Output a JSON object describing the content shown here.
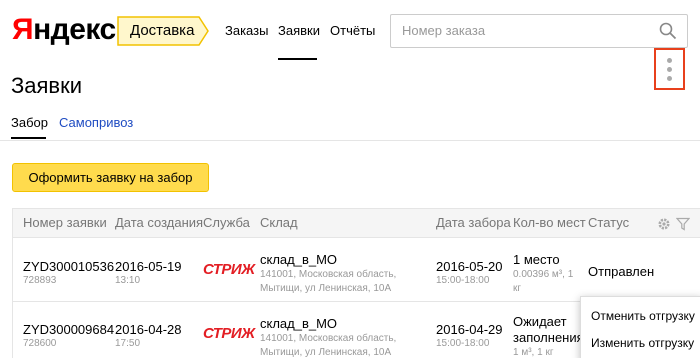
{
  "header": {
    "logo_first": "Я",
    "logo_rest": "ндекс",
    "service": "Доставка",
    "nav": [
      "Заказы",
      "Заявки",
      "Отчёты"
    ],
    "search_placeholder": "Номер заказа"
  },
  "page": {
    "title": "Заявки",
    "tabs": [
      "Забор",
      "Самопривоз"
    ],
    "order_button": "Оформить заявку на забор"
  },
  "table": {
    "headers": [
      "Номер заявки",
      "Дата создания",
      "Служба",
      "Склад",
      "Дата забора",
      "Кол-во мест",
      "Статус"
    ],
    "rows": [
      {
        "number": "ZYD300010536",
        "number_sub": "728893",
        "created": "2016-05-19",
        "created_time": "13:10",
        "carrier": "СТРИЖ",
        "warehouse": "склад_в_МО",
        "address1": "141001, Московская область,",
        "address2": "Мытищи, ул Ленинская, 10А",
        "pickup_date": "2016-05-20",
        "pickup_time": "15:00-18:00",
        "places": "1 место",
        "places_sub1": "0.00396 м³, 1",
        "places_sub2": "кг",
        "status": "Отправлен"
      },
      {
        "number": "ZYD300009684",
        "number_sub": "728600",
        "created": "2016-04-28",
        "created_time": "17:50",
        "carrier": "СТРИЖ",
        "warehouse": "склад_в_МО",
        "address1": "141001, Московская область,",
        "address2": "Мытищи, ул Ленинская, 10А",
        "pickup_date": "2016-04-29",
        "pickup_time": "15:00-18:00",
        "places": "Ожидает",
        "places_line2": "заполнения",
        "places_sub1": "1 м³, 1 кг",
        "status": ""
      }
    ]
  },
  "dropdown": {
    "items": [
      "Отменить отгрузку",
      "Изменить отгрузку"
    ]
  },
  "colors": {
    "brand_red": "#ff0000",
    "button_yellow": "#ffdb4d",
    "link_blue": "#1f4cc2",
    "highlight": "#e8401c"
  },
  "icons": [
    "search-icon",
    "gear-icon",
    "filter-icon",
    "more-vertical-icon"
  ]
}
